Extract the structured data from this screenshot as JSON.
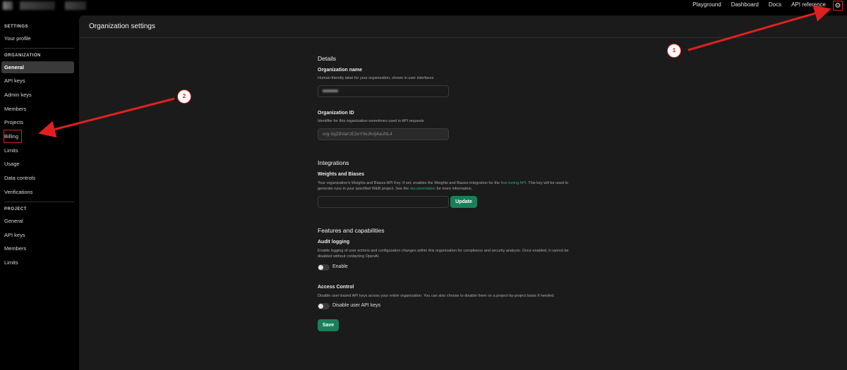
{
  "top_nav": {
    "items": [
      "Playground",
      "Dashboard",
      "Docs",
      "API reference"
    ],
    "settings_icon": "gear-icon"
  },
  "sidebar": {
    "settings_title": "SETTINGS",
    "your_profile": "Your profile",
    "organization_title": "ORGANIZATION",
    "org_items": [
      "General",
      "API keys",
      "Admin keys",
      "Members",
      "Projects",
      "Billing",
      "Limits",
      "Usage",
      "Data controls",
      "Verifications"
    ],
    "project_title": "PROJECT",
    "project_items": [
      "General",
      "API keys",
      "Members",
      "Limits"
    ]
  },
  "page": {
    "title": "Organization settings"
  },
  "details": {
    "section_title": "Details",
    "org_name_label": "Organization name",
    "org_name_desc": "Human-friendly label for your organization, shown in user interfaces",
    "org_id_label": "Organization ID",
    "org_id_desc": "Identifier for this organization sometimes used in API requests",
    "org_id_value": "org-5qZ8VarUE3oYhkJKdj4auNL4"
  },
  "integrations": {
    "section_title": "Integrations",
    "wandb_label": "Weights and Biases",
    "wandb_desc_1": "Your organization's Weights and Biases API Key. If set, enables the Weights and Biases integration for the",
    "wandb_link_1": "fine-tuning API",
    "wandb_desc_2": ". This key will be used to",
    "wandb_desc_3": "generate runs in your specified W&B project. See the",
    "wandb_link_2": "documentation",
    "wandb_desc_4": "for more information.",
    "update_button": "Update"
  },
  "features": {
    "section_title": "Features and capabilities",
    "audit_label": "Audit logging",
    "audit_desc_1": "Enable logging of user actions and configuration changes within this organization for compliance and security analysis. Once enabled, it cannot be",
    "audit_desc_2": "disabled without contacting OpenAI.",
    "audit_toggle_label": "Enable",
    "access_label": "Access Control",
    "access_desc": "Disable user-based API keys across your entire organization. You can also choose to disable them on a project-by-project basis if needed.",
    "access_toggle_label": "Disable user API keys",
    "save_button": "Save"
  },
  "annotations": {
    "marker_1": "1",
    "marker_2": "2",
    "color": "#e02020"
  }
}
